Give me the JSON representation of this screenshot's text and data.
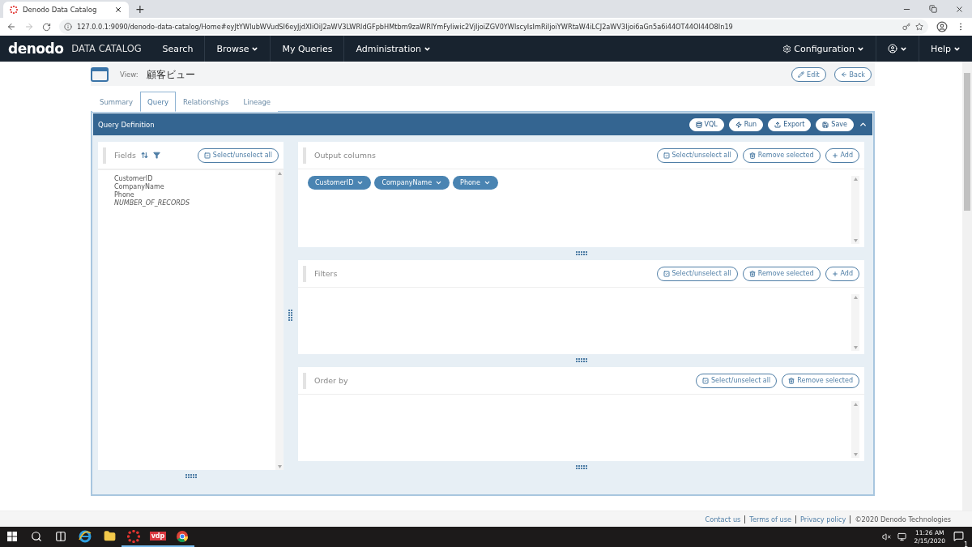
{
  "browser": {
    "tab_title": "Denodo Data Catalog",
    "new_tab": "+",
    "url": "127.0.0.1:9090/denodo-data-catalog/Home#eyJtYWlubWVudSI6eyJjdXIiOiJ2aWV3LWRldGFpbHMtbm9zaWRlYmFyliwic2VjIjoiZGV0YWlscyIsImRiIjoiYWRtaW4iLCJ2aWV3Ijoi6aGn5a6i44OT44Ol44O8In19"
  },
  "navbar": {
    "logo": "denodo",
    "product": "DATA CATALOG",
    "items": [
      {
        "label": "Search",
        "dropdown": false
      },
      {
        "label": "Browse",
        "dropdown": true
      },
      {
        "label": "My Queries",
        "dropdown": false
      },
      {
        "label": "Administration",
        "dropdown": true
      }
    ],
    "right_items": [
      {
        "kind": "config",
        "label": "Configuration"
      },
      {
        "kind": "user"
      },
      {
        "kind": "help",
        "label": "Help"
      }
    ]
  },
  "view": {
    "label": "View:",
    "name": "顧客ビュー",
    "buttons": [
      {
        "kind": "edit",
        "label": "Edit"
      },
      {
        "kind": "back",
        "label": "Back"
      }
    ]
  },
  "tabs": [
    {
      "label": "Summary",
      "selected": false
    },
    {
      "label": "Query",
      "selected": true
    },
    {
      "label": "Relationships",
      "selected": false
    },
    {
      "label": "Lineage",
      "selected": false
    }
  ],
  "query": {
    "title": "Query Definition",
    "buttons": [
      {
        "kind": "vql",
        "label": "VQL"
      },
      {
        "kind": "run",
        "label": "Run"
      },
      {
        "kind": "export",
        "label": "Export"
      },
      {
        "kind": "save",
        "label": "Save"
      }
    ],
    "fields": {
      "title": "Fields",
      "select_all": "Select/unselect all",
      "items": [
        {
          "name": "CustomerID",
          "italic": false
        },
        {
          "name": "CompanyName",
          "italic": false
        },
        {
          "name": "Phone",
          "italic": false
        },
        {
          "name": "NUMBER_OF_RECORDS",
          "italic": true
        }
      ]
    },
    "sections": [
      {
        "title": "Output columns",
        "buttons": [
          {
            "kind": "select",
            "label": "Select/unselect all"
          },
          {
            "kind": "remove",
            "label": "Remove selected"
          },
          {
            "kind": "add",
            "label": "Add"
          }
        ],
        "chips": [
          "CustomerID",
          "CompanyName",
          "Phone"
        ]
      },
      {
        "title": "Filters",
        "buttons": [
          {
            "kind": "select",
            "label": "Select/unselect all"
          },
          {
            "kind": "remove",
            "label": "Remove selected"
          },
          {
            "kind": "add",
            "label": "Add"
          }
        ]
      },
      {
        "title": "Order by",
        "buttons": [
          {
            "kind": "select",
            "label": "Select/unselect all"
          },
          {
            "kind": "remove",
            "label": "Remove selected"
          }
        ]
      }
    ]
  },
  "footer": {
    "links": [
      "Contact us",
      "Terms of use",
      "Privacy policy"
    ],
    "copyright": "©2020 Denodo Technologies"
  },
  "taskbar": {
    "apps": [
      {
        "kind": "search",
        "running": false
      },
      {
        "kind": "taskview",
        "running": false
      },
      {
        "kind": "ie",
        "running": false
      },
      {
        "kind": "explorer",
        "running": false
      },
      {
        "kind": "denodo",
        "running": true
      },
      {
        "kind": "vdp",
        "label": "vdp",
        "running": true
      },
      {
        "kind": "chrome",
        "running": true
      }
    ],
    "time": "11:26 AM",
    "date": "2/15/2020",
    "notifications": "1"
  }
}
